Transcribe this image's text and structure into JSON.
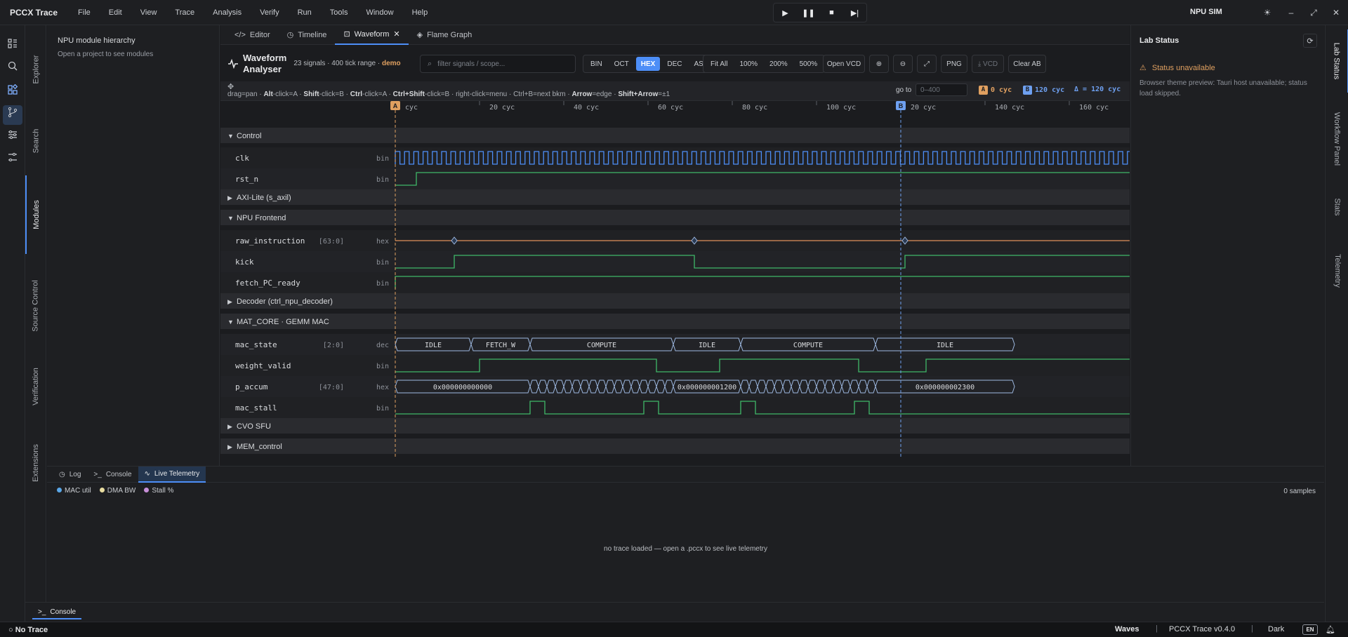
{
  "app": {
    "title": "PCCX Trace",
    "sim_mode": "NPU SIM"
  },
  "menu": [
    "File",
    "Edit",
    "View",
    "Trace",
    "Analysis",
    "Verify",
    "Run",
    "Tools",
    "Window",
    "Help"
  ],
  "left_vtabs": {
    "explorer": "Explorer",
    "search": "Search",
    "modules": "Modules",
    "source_control": "Source Control",
    "verification": "Verification",
    "extensions": "Extensions"
  },
  "sidebar": {
    "title": "NPU module hierarchy",
    "subtitle": "Open a project to see modules"
  },
  "editor_tabs": {
    "editor": "Editor",
    "timeline": "Timeline",
    "waveform": "Waveform",
    "flame": "Flame Graph"
  },
  "toolbar": {
    "title_line1": "Waveform",
    "title_line2": "Analyser",
    "meta": "23 signals · 400 tick range · ",
    "meta_tag": "demo",
    "filter_placeholder": "filter signals / scope...",
    "radix": [
      "BIN",
      "OCT",
      "HEX",
      "DEC",
      "ASCII"
    ],
    "radix_active": "HEX",
    "zoom": [
      "Fit All",
      "100%",
      "200%",
      "500%"
    ],
    "open_vcd": "Open VCD",
    "png": "PNG",
    "vcd": "VCD",
    "clear_ab": "Clear AB"
  },
  "hint": {
    "parts": [
      "drag=pan · ",
      "Alt",
      "-click=A · ",
      "Shift",
      "-click=B · ",
      "Ctrl",
      "-click=A · ",
      "Ctrl+Shift",
      "-click=B · right-click=menu · Ctrl+B=next bkm · ",
      "Arrow",
      "=edge · ",
      "Shift+Arrow",
      "=±1"
    ],
    "goto_label": "go to",
    "goto_placeholder": "0–400",
    "cursor_a_label": "A",
    "cursor_a": "0 cyc",
    "cursor_b_label": "B",
    "cursor_b": "120 cyc",
    "delta": "Δ = 120 cyc"
  },
  "waveform": {
    "ticks": [
      "cyc",
      "20 cyc",
      "40 cyc",
      "60 cyc",
      "80 cyc",
      "100 cyc",
      "20 cyc",
      "140 cyc",
      "160 cyc"
    ],
    "cursor_a_label": "A",
    "cursor_b_label": "B",
    "groups": [
      {
        "name": "Control",
        "expanded": true
      },
      {
        "name": "AXI-Lite (s_axil)",
        "expanded": false
      },
      {
        "name": "NPU Frontend",
        "expanded": true
      },
      {
        "name": "Decoder (ctrl_npu_decoder)",
        "expanded": false
      },
      {
        "name": "MAT_CORE · GEMM MAC",
        "expanded": true
      },
      {
        "name": "CVO SFU",
        "expanded": false
      },
      {
        "name": "MEM_control",
        "expanded": false
      }
    ],
    "signals": [
      {
        "name": "clk",
        "width": "",
        "radix": "bin"
      },
      {
        "name": "rst_n",
        "width": "",
        "radix": "bin"
      },
      {
        "name": "raw_instruction",
        "width": "[63:0]",
        "radix": "hex"
      },
      {
        "name": "kick",
        "width": "",
        "radix": "bin"
      },
      {
        "name": "fetch_PC_ready",
        "width": "",
        "radix": "bin"
      },
      {
        "name": "mac_state",
        "width": "[2:0]",
        "radix": "dec"
      },
      {
        "name": "weight_valid",
        "width": "",
        "radix": "bin"
      },
      {
        "name": "p_accum",
        "width": "[47:0]",
        "radix": "hex"
      },
      {
        "name": "mac_stall",
        "width": "",
        "radix": "bin"
      }
    ],
    "mac_state_values": [
      "IDLE",
      "FETCH_W",
      "COMPUTE",
      "IDLE",
      "COMPUTE",
      "IDLE"
    ],
    "p_accum_values": [
      "0x000000000000",
      "0x000000001200",
      "0x000000002300"
    ],
    "colors": {
      "clk": "#4d8ef7",
      "bin": "#3fb868",
      "bus": "#e0905a",
      "state": "#9db8e0",
      "cursor_a": "#e0a060",
      "cursor_b": "#6ea0f0"
    }
  },
  "lab_status": {
    "title": "Lab Status",
    "warning": "Status unavailable",
    "note": "Browser theme preview: Tauri host unavailable; status load skipped."
  },
  "right_vtabs": {
    "lab_status": "Lab Status",
    "workflow": "Workflow Panel",
    "stats": "Stats",
    "telemetry": "Telemetry"
  },
  "bottom": {
    "tabs": {
      "log": "Log",
      "console": "Console",
      "telemetry": "Live Telemetry"
    },
    "legend": [
      {
        "label": "MAC util",
        "color": "#5aa7e8"
      },
      {
        "label": "DMA BW",
        "color": "#e8dca0"
      },
      {
        "label": "Stall %",
        "color": "#c78fd8"
      }
    ],
    "samples": "0 samples",
    "empty": "no trace loaded — open a .pccx to see live telemetry"
  },
  "console_strip": {
    "tab": "Console"
  },
  "status": {
    "trace": "No Trace",
    "waves": "Waves",
    "version": "PCCX Trace v0.4.0",
    "theme": "Dark",
    "lang": "EN"
  }
}
